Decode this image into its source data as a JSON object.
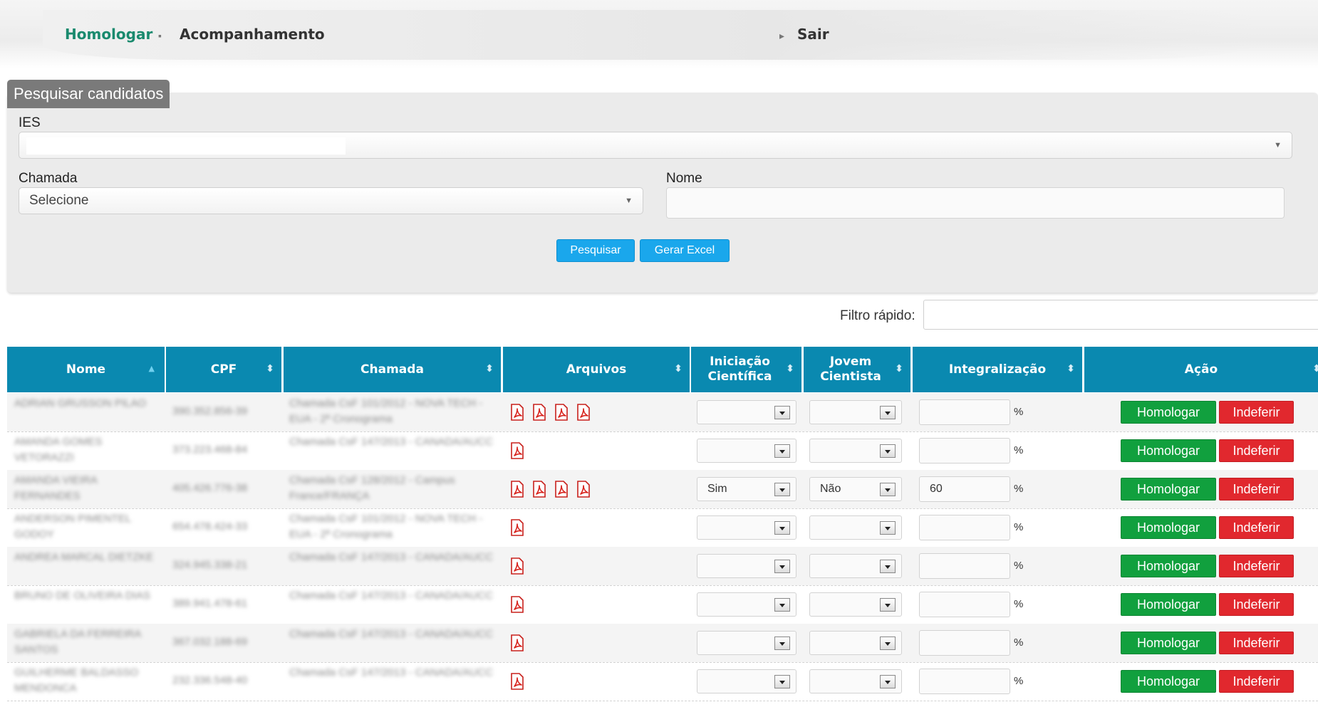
{
  "nav": {
    "homologar": "Homologar",
    "acompanhamento": "Acompanhamento",
    "sair": "Sair"
  },
  "search": {
    "title": "Pesquisar candidatos",
    "ies_label": "IES",
    "ies_value": "",
    "chamada_label": "Chamada",
    "chamada_value": "Selecione",
    "nome_label": "Nome",
    "nome_value": "",
    "pesquisar": "Pesquisar",
    "gerar_excel": "Gerar Excel"
  },
  "filter": {
    "label": "Filtro rápido:",
    "value": ""
  },
  "table": {
    "headers": [
      "Nome",
      "CPF",
      "Chamada",
      "Arquivos",
      "Iniciação Científica",
      "Jovem Cientista",
      "Integralização",
      "Ação"
    ],
    "percent_sign": "%",
    "homologar_label": "Homologar",
    "indeferir_label": "Indeferir",
    "rows": [
      {
        "nome": "ADRIAN GRUSSON PILAO",
        "cpf": "390.352.856-39",
        "chamada": "Chamada CsF 101/2012 - NOVA TECH - EUA - 2ª Cronograma",
        "files": 4,
        "ic": "",
        "jc": "",
        "int": ""
      },
      {
        "nome": "AMANDA GOMES VETORAZZI",
        "cpf": "373.223.468-84",
        "chamada": "Chamada CsF 147/2013 - CANADA/AUCC",
        "files": 1,
        "ic": "",
        "jc": "",
        "int": ""
      },
      {
        "nome": "AMANDA VIEIRA FERNANDES",
        "cpf": "405.426.776-38",
        "chamada": "Chamada CsF 128/2012 - Campus France/FRANÇA",
        "files": 4,
        "ic": "Sim",
        "jc": "Não",
        "int": "60"
      },
      {
        "nome": "ANDERSON PIMENTEL GODOY",
        "cpf": "654.478.424-33",
        "chamada": "Chamada CsF 101/2012 - NOVA TECH - EUA - 2ª Cronograma",
        "files": 1,
        "ic": "",
        "jc": "",
        "int": ""
      },
      {
        "nome": "ANDREA MARCAL DIETZKE",
        "cpf": "324.945.338-21",
        "chamada": "Chamada CsF 147/2013 - CANADA/AUCC",
        "files": 1,
        "ic": "",
        "jc": "",
        "int": ""
      },
      {
        "nome": "BRUNO DE OLIVEIRA DIAS",
        "cpf": "389.941.478-61",
        "chamada": "Chamada CsF 147/2013 - CANADA/AUCC",
        "files": 1,
        "ic": "",
        "jc": "",
        "int": ""
      },
      {
        "nome": "GABRIELA DA FERREIRA SANTOS",
        "cpf": "367.032.188-69",
        "chamada": "Chamada CsF 147/2013 - CANADA/AUCC",
        "files": 1,
        "ic": "",
        "jc": "",
        "int": ""
      },
      {
        "nome": "GUILHERME BALDASSO MENDONCA",
        "cpf": "232.336.548-40",
        "chamada": "Chamada CsF 147/2013 - CANADA/AUCC",
        "files": 1,
        "ic": "",
        "jc": "",
        "int": ""
      }
    ]
  }
}
